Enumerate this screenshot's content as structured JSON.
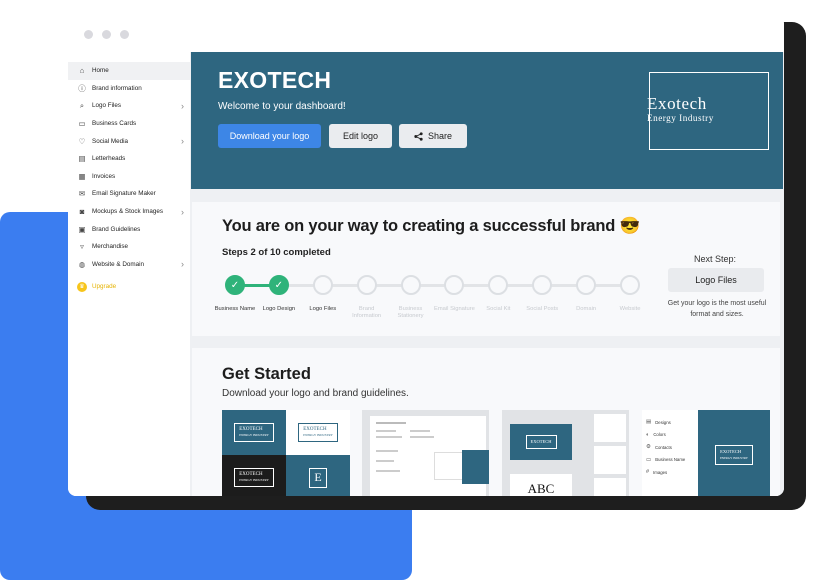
{
  "sidebar": {
    "items": [
      {
        "label": "Home",
        "icon": "home-icon",
        "glyph": "⌂",
        "chevron": false
      },
      {
        "label": "Brand information",
        "icon": "info-icon",
        "glyph": "ⓘ",
        "chevron": false
      },
      {
        "label": "Logo Files",
        "icon": "paperclip-icon",
        "glyph": "⌕",
        "chevron": true
      },
      {
        "label": "Business Cards",
        "icon": "card-icon",
        "glyph": "▭",
        "chevron": false
      },
      {
        "label": "Social Media",
        "icon": "thumbs-up-icon",
        "glyph": "♡",
        "chevron": true
      },
      {
        "label": "Letterheads",
        "icon": "document-icon",
        "glyph": "▤",
        "chevron": false
      },
      {
        "label": "Invoices",
        "icon": "invoice-icon",
        "glyph": "▦",
        "chevron": false
      },
      {
        "label": "Email Signature Maker",
        "icon": "email-icon",
        "glyph": "✉",
        "chevron": false
      },
      {
        "label": "Mockups & Stock Images",
        "icon": "camera-icon",
        "glyph": "◙",
        "chevron": true
      },
      {
        "label": "Brand Guidelines",
        "icon": "book-icon",
        "glyph": "▣",
        "chevron": false
      },
      {
        "label": "Merchandise",
        "icon": "shirt-icon",
        "glyph": "▿",
        "chevron": false
      },
      {
        "label": "Website & Domain",
        "icon": "globe-icon",
        "glyph": "◍",
        "chevron": true
      }
    ],
    "upgrade": {
      "label": "Upgrade",
      "icon": "crown-icon",
      "glyph": "♛"
    }
  },
  "hero": {
    "title": "EXOTECH",
    "subtitle": "Welcome to your dashboard!",
    "download_label": "Download your logo",
    "edit_label": "Edit logo",
    "share_label": "Share",
    "logo_main": "Exotech",
    "logo_sub": "Energy Industry"
  },
  "progress": {
    "title": "You are on your way to creating a successful brand 😎",
    "subtitle": "Steps 2 of 10 completed",
    "completed": 2,
    "total": 10,
    "steps": [
      "Business Name",
      "Logo Design",
      "Logo Files",
      "Brand Information",
      "Business Stationery",
      "Email Signature",
      "Social Kit",
      "Social Posts",
      "Domain",
      "Website"
    ],
    "next_title": "Next Step:",
    "next_button": "Logo Files",
    "next_desc": "Get your logo is the most useful format and sizes."
  },
  "get_started": {
    "title": "Get Started",
    "subtitle": "Download your logo and brand guidelines.",
    "mini_logo": "EXOTECH",
    "mini_logo_sub": "ENERGY INDUSTRY",
    "monogram": "E",
    "font_sample": "ABC",
    "guideline_items": [
      "Designs",
      "Colors",
      "Contacts",
      "Business Name",
      "Images"
    ]
  },
  "colors": {
    "brand": "#2e6680",
    "primary_button": "#3d86e6",
    "success": "#2fb37a",
    "upgrade": "#f7c51b",
    "accent_card": "#3b7df0"
  }
}
